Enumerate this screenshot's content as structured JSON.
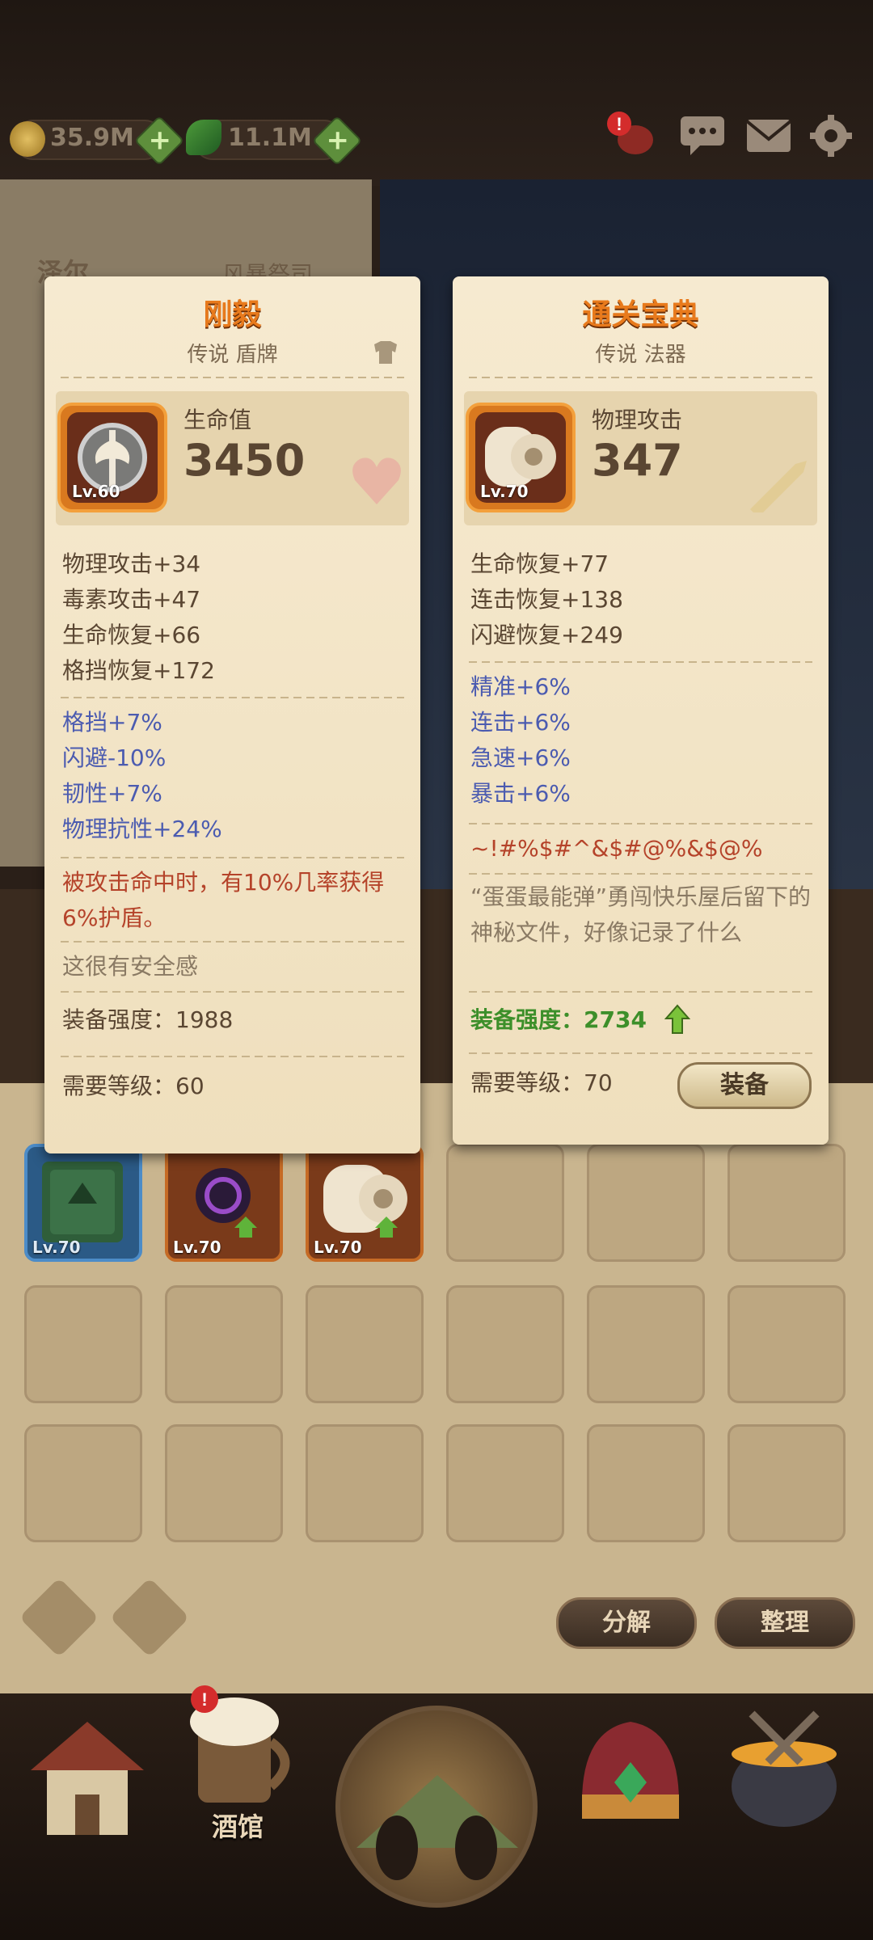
{
  "currency": {
    "gold": "35.9M",
    "leaf": "11.1M",
    "plus": "+"
  },
  "top_icons": {
    "alert": "!"
  },
  "background": {
    "hero_name": "泽尔",
    "hero_class": "风暴祭司"
  },
  "left_card": {
    "title": "刚毅",
    "subtitle": "传说 盾牌",
    "level": "Lv.60",
    "main_stat_label": "生命值",
    "main_stat_value": "3450",
    "base_stats": [
      "物理攻击+34",
      "毒素攻击+47",
      "生命恢复+66",
      "格挡恢复+172"
    ],
    "bonus_stats": [
      "格挡+7%",
      "闪避-10%",
      "韧性+7%",
      "物理抗性+24%"
    ],
    "special": "被攻击命中时，有10%几率获得6%护盾。",
    "flavor": "这很有安全感",
    "strength": "装备强度：1988",
    "required": "需要等级：60"
  },
  "right_card": {
    "title": "通关宝典",
    "subtitle": "传说 法器",
    "level": "Lv.70",
    "main_stat_label": "物理攻击",
    "main_stat_value": "347",
    "base_stats": [
      "生命恢复+77",
      "连击恢复+138",
      "闪避恢复+249"
    ],
    "bonus_stats": [
      "精准+6%",
      "连击+6%",
      "急速+6%",
      "暴击+6%"
    ],
    "special": "~!#%$#^&$#@%&$@%",
    "flavor": "“蛋蛋最能弹”勇闯快乐屋后留下的神秘文件，好像记录了什么",
    "strength": "装备强度：2734",
    "required": "需要等级：70",
    "equip_button": "装备"
  },
  "inventory": {
    "items": [
      {
        "level": "Lv.70"
      },
      {
        "level": "Lv.70"
      },
      {
        "level": "Lv.70"
      }
    ],
    "decompose_button": "分解",
    "sort_button": "整理"
  },
  "nav": {
    "tavern_label": "酒馆",
    "alert": "!"
  },
  "colors": {
    "title_orange": "#e87a1c",
    "bonus_blue": "#4b5bb0",
    "special_red": "#b5432a",
    "strength_green": "#3d8f2a"
  }
}
